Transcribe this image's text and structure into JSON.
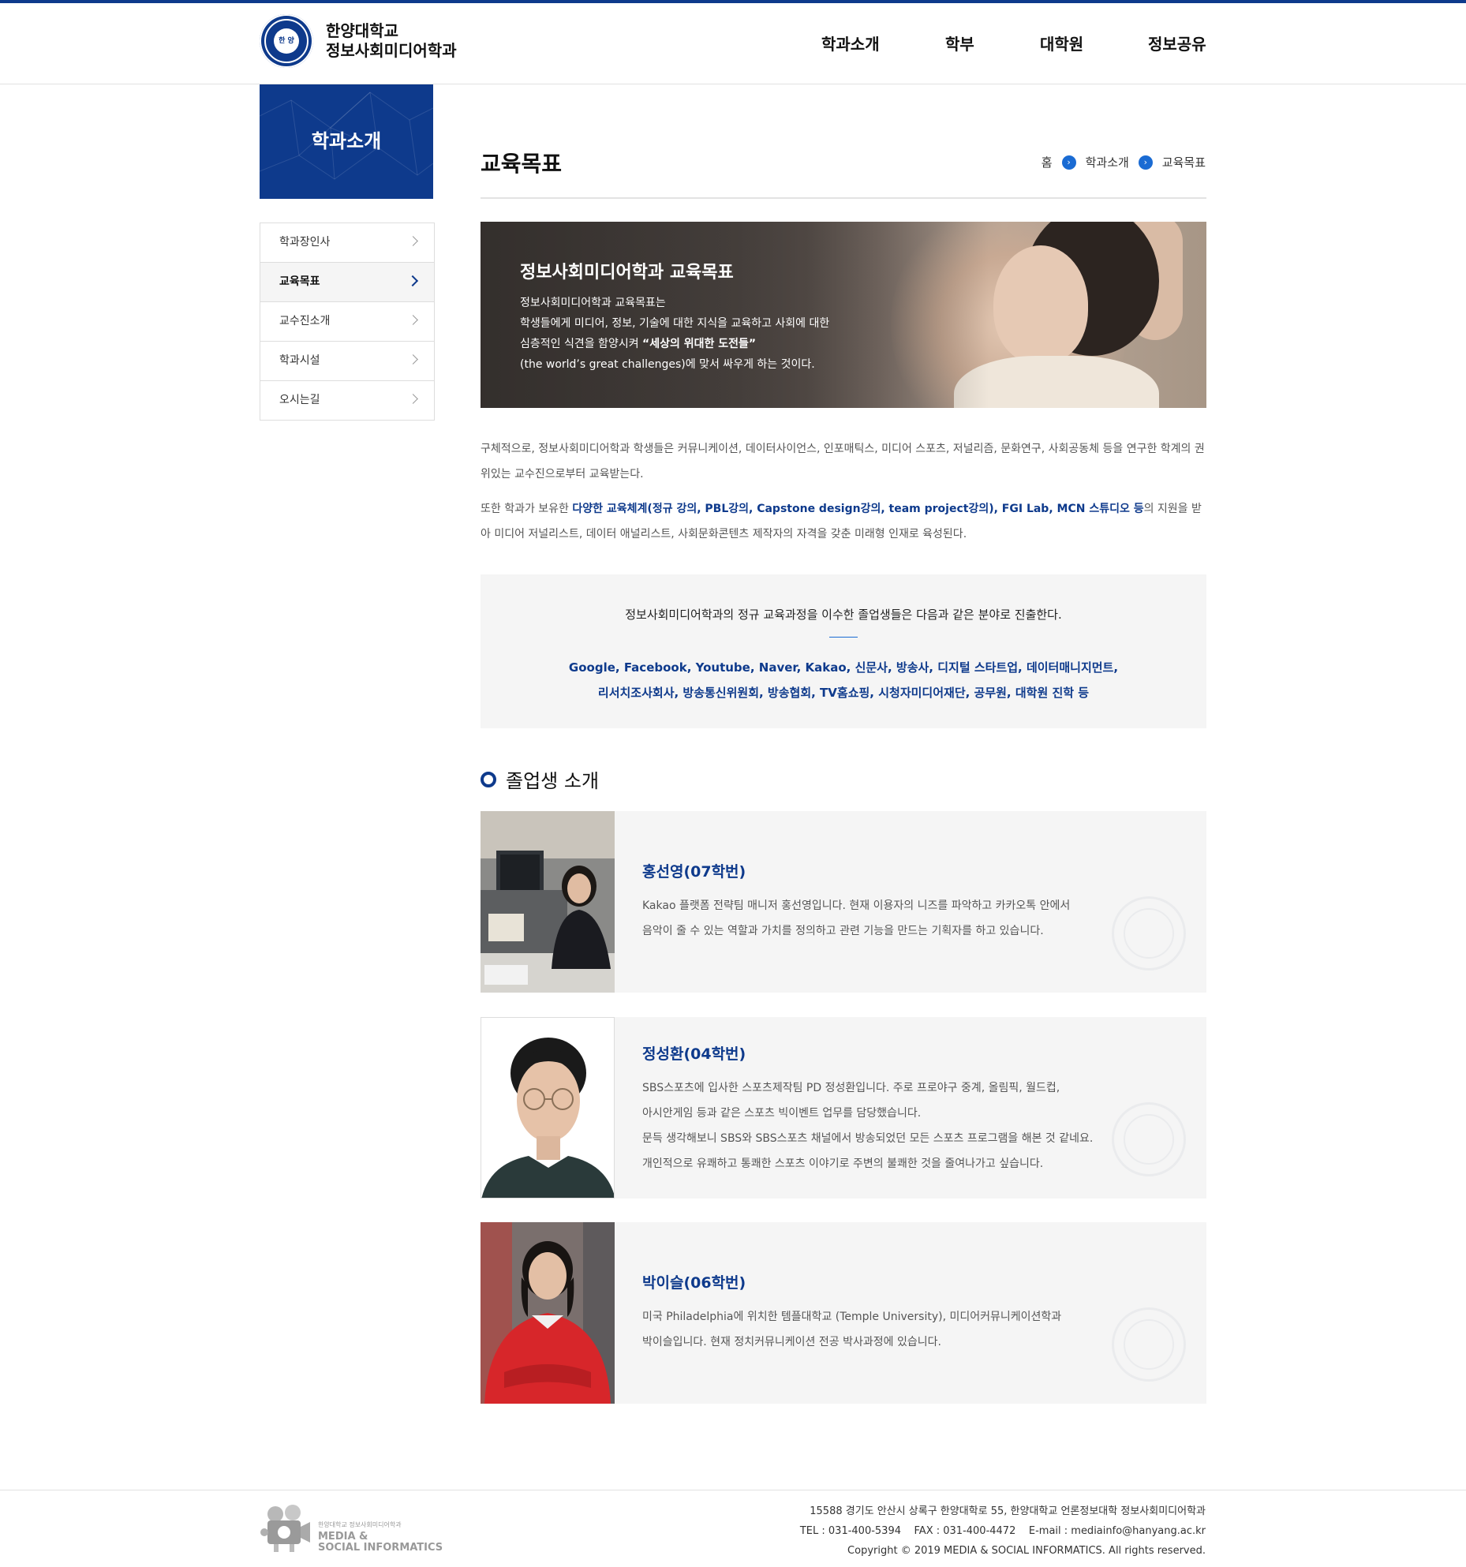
{
  "header": {
    "logo_line1": "한양대학교",
    "logo_line2": "정보사회미디어학과",
    "seal_text": "한 양",
    "nav": [
      "학과소개",
      "학부",
      "대학원",
      "정보공유"
    ]
  },
  "sidebar": {
    "title": "학과소개",
    "items": [
      {
        "label": "학과장인사",
        "active": false
      },
      {
        "label": "교육목표",
        "active": true
      },
      {
        "label": "교수진소개",
        "active": false
      },
      {
        "label": "학과시설",
        "active": false
      },
      {
        "label": "오시는길",
        "active": false
      }
    ]
  },
  "page": {
    "title": "교육목표",
    "breadcrumb": [
      "홈",
      "학과소개",
      "교육목표"
    ]
  },
  "banner": {
    "title": "정보사회미디어학과 교육목표",
    "line1": "정보사회미디어학과 교육목표는",
    "line2": "학생들에게 미디어, 정보, 기술에 대한 지식을 교육하고 사회에 대한",
    "line3_pre": "심층적인 식견을 함양시켜 ",
    "line3_bold": "“세상의 위대한 도전들”",
    "line4": "(the world’s great challenges)에 맞서 싸우게 하는 것이다."
  },
  "intro": {
    "p1": "구체적으로, 정보사회미디어학과 학생들은 커뮤니케이션, 데이터사이언스, 인포매틱스, 미디어 스포츠, 저널리즘, 문화연구, 사회공동체 등을 연구한 학계의 권위있는 교수진으로부터 교육받는다.",
    "p2_pre": "또한 학과가 보유한 ",
    "p2_bold": "다양한 교육체계(정규 강의, PBL강의, Capstone design강의, team project강의), FGI Lab, MCN 스튜디오 등",
    "p2_post": "의 지원을 받아 미디어 저널리스트, 데이터 애널리스트, 사회문화콘텐츠 제작자의 자격을 갖춘 미래형 인재로 육성된다."
  },
  "careers": {
    "title": "정보사회미디어학과의 정규 교육과정을 이수한 졸업생들은 다음과 같은 분야로 진출한다.",
    "line1": "Google, Facebook, Youtube, Naver, Kakao, 신문사, 방송사, 디지털 스타트업, 데이터매니지먼트,",
    "line2": "리서치조사회사, 방송통신위원회, 방송협회, TV홈쇼핑, 시청자미디어재단, 공무원, 대학원 진학 등"
  },
  "alumni": {
    "section_title": "졸업생 소개",
    "items": [
      {
        "name": "홍선영(07학번)",
        "lines": [
          "Kakao 플랫폼 전략팀 매니저 홍선영입니다. 현재 이용자의 니즈를 파악하고 카카오톡 안에서",
          "음악이 줄 수 있는 역할과 가치를 정의하고 관련 기능을 만드는 기획자를 하고 있습니다."
        ]
      },
      {
        "name": "정성환(04학번)",
        "lines": [
          "SBS스포츠에 입사한 스포츠제작팀 PD 정성환입니다. 주로 프로야구 중계, 올림픽, 월드컵,",
          "아시안게임 등과 같은 스포츠 빅이벤트 업무를 담당했습니다.",
          "문득 생각해보니 SBS와 SBS스포츠 채널에서 방송되었던 모든 스포츠 프로그램을 해본 것 같네요.",
          "개인적으로 유쾌하고 통쾌한 스포츠 이야기로 주변의 불쾌한 것을 줄여나가고 싶습니다."
        ]
      },
      {
        "name": "박이슬(06학번)",
        "lines": [
          "미국 Philadelphia에 위치한 템플대학교 (Temple University), 미디어커뮤니케이션학과",
          "박이슬입니다. 현재 정치커뮤니케이션 전공 박사과정에 있습니다."
        ]
      }
    ]
  },
  "footer": {
    "logo_small": "한양대학교 정보사회미디어학과",
    "logo_big1": "MEDIA &",
    "logo_big2": "SOCIAL INFORMATICS",
    "address": "15588 경기도 안산시 상록구 한양대학로 55, 한양대학교 언론정보대학 정보사회미디어학과",
    "contact": "TEL : 031-400-5394    FAX : 031-400-4472    E-mail : mediainfo@hanyang.ac.kr",
    "copyright": "Copyright © 2019 MEDIA & SOCIAL INFORMATICS. All rights reserved."
  },
  "colors": {
    "brand": "#0e3a8c",
    "accent": "#1a6bd3",
    "box_bg": "#f5f5f5"
  },
  "icons": {
    "breadcrumb_separator": "chevron-right-icon",
    "lnb_arrow": "chevron-right-icon",
    "section_bullet": "circle-icon"
  }
}
